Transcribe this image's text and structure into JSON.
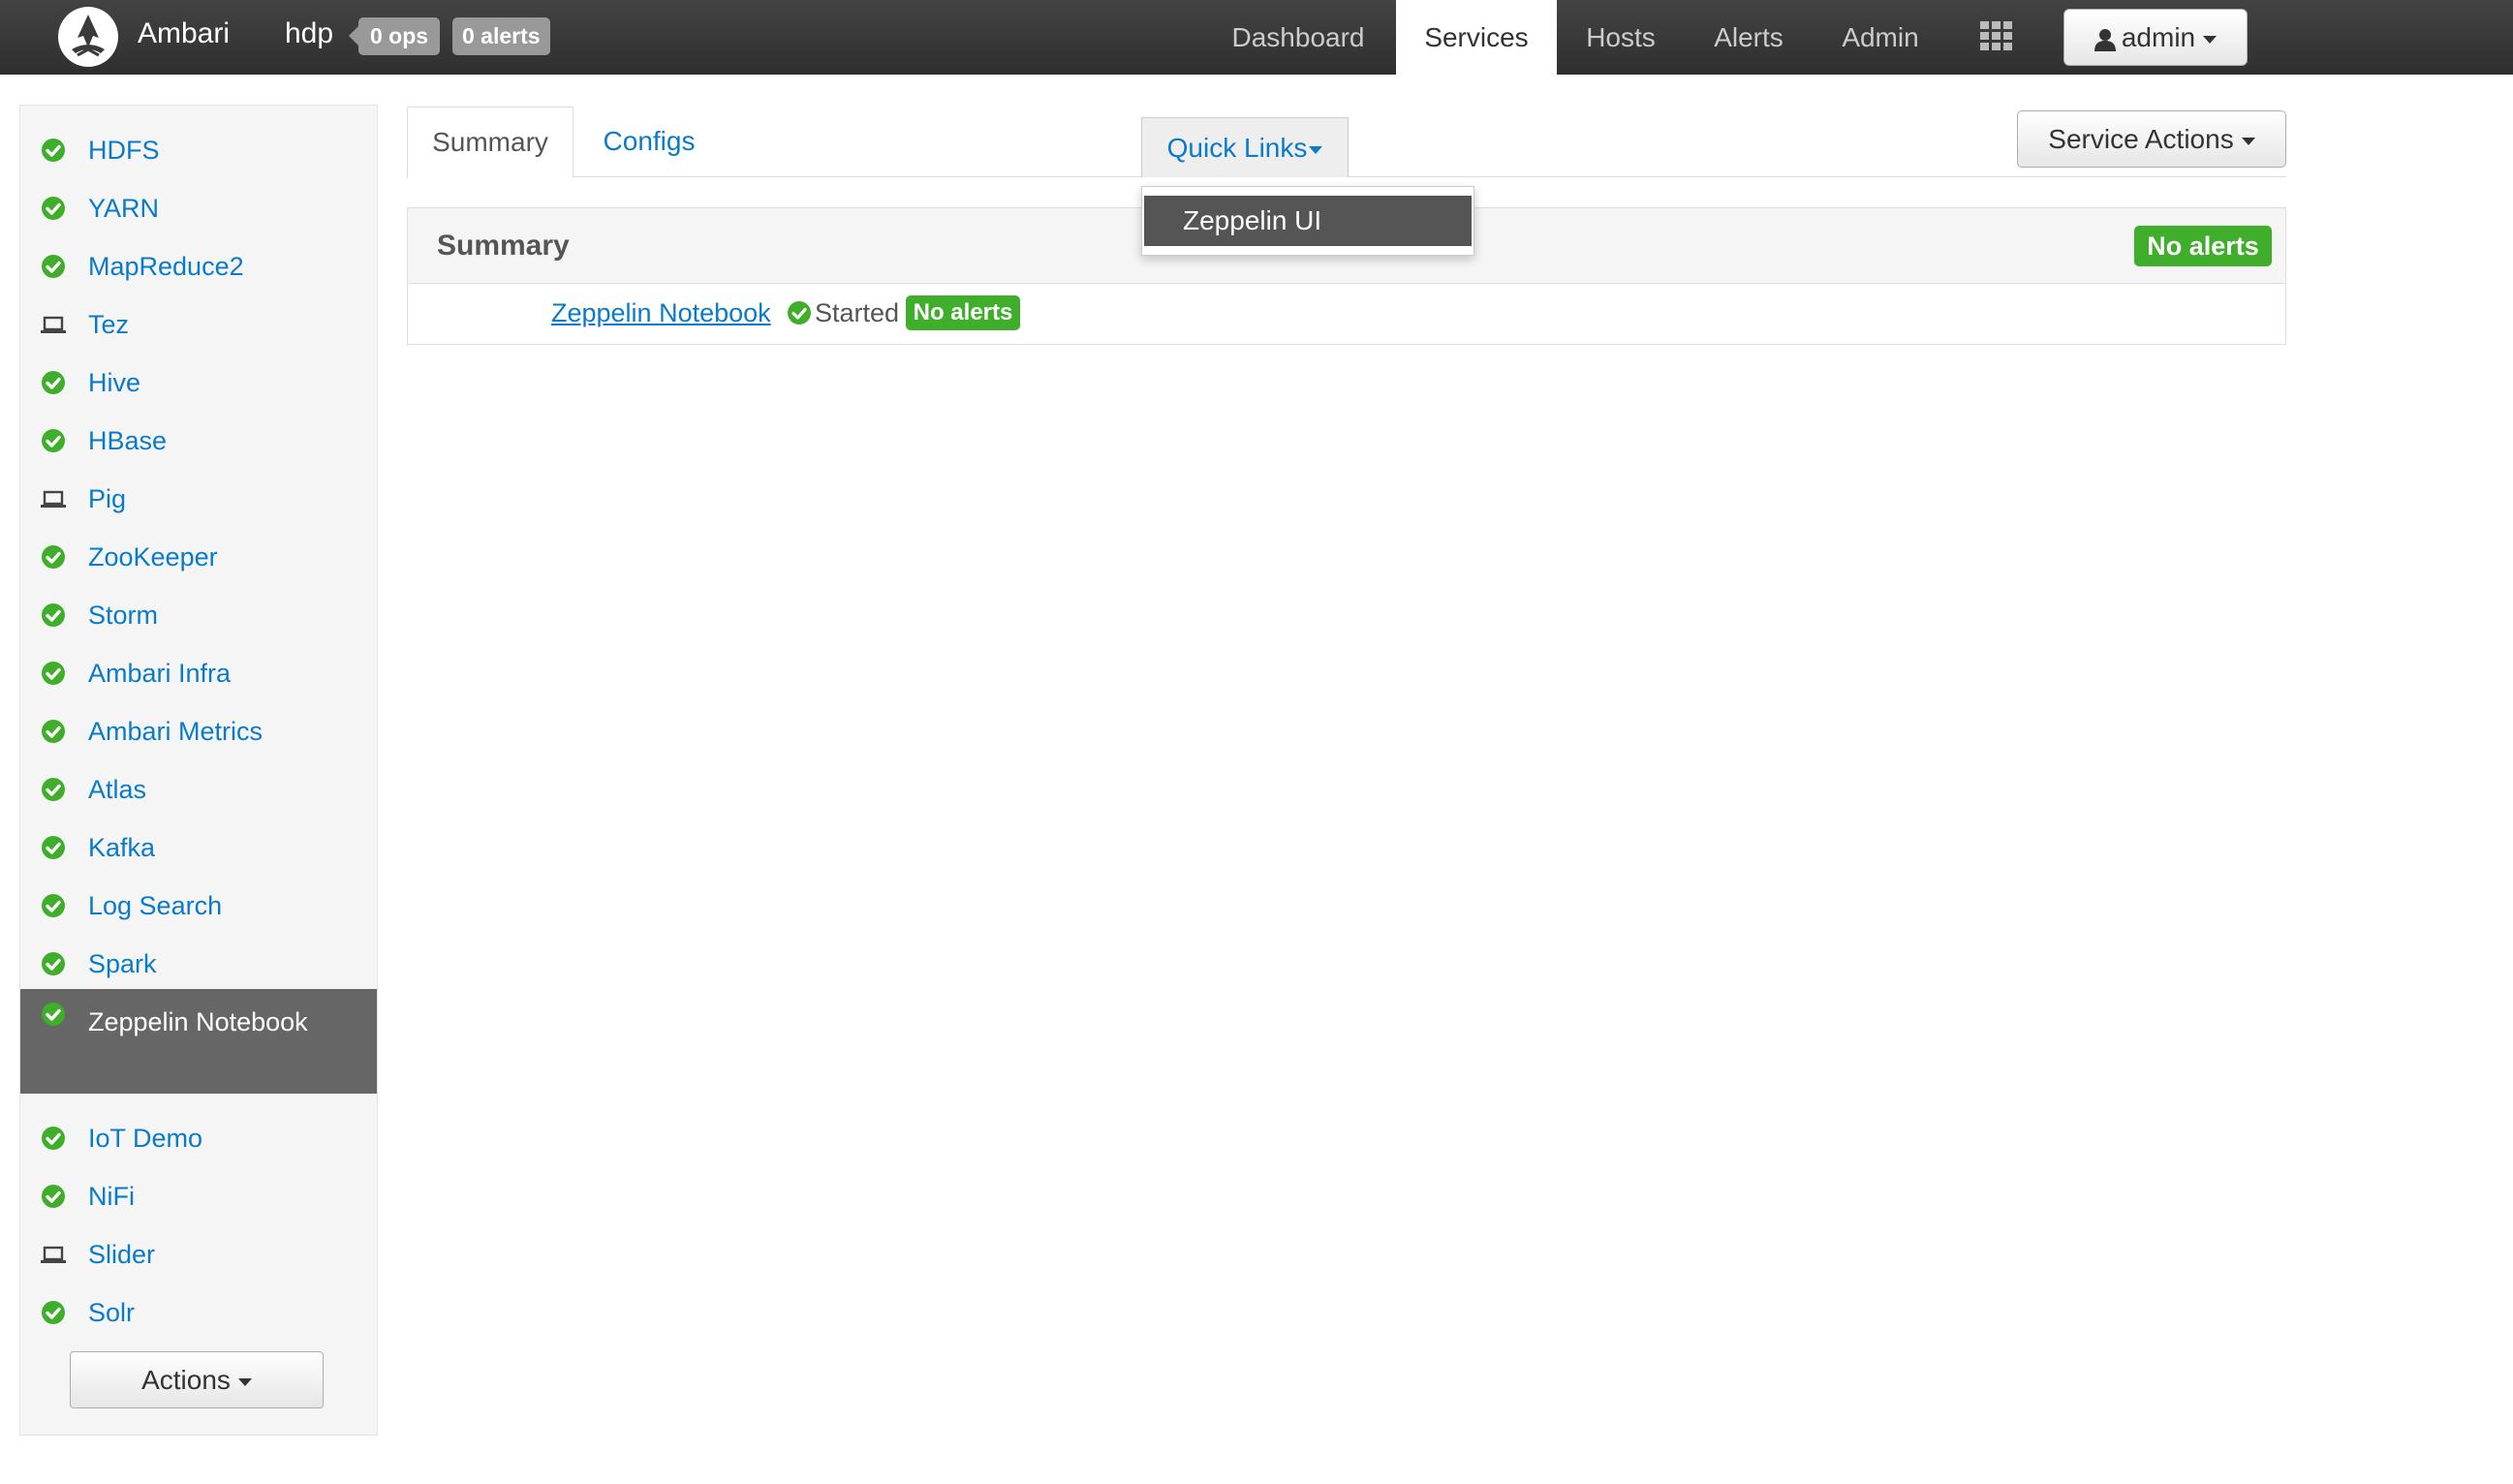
{
  "app": {
    "brand": "Ambari",
    "cluster": "hdp",
    "ops_badge": "0 ops",
    "alerts_badge": "0 alerts"
  },
  "nav": {
    "items": [
      {
        "label": "Dashboard",
        "active": false
      },
      {
        "label": "Services",
        "active": true
      },
      {
        "label": "Hosts",
        "active": false
      },
      {
        "label": "Alerts",
        "active": false
      },
      {
        "label": "Admin",
        "active": false
      }
    ],
    "apps_icon": "grid-icon",
    "user": "admin"
  },
  "sidebar": {
    "services": [
      {
        "label": "HDFS",
        "icon": "check-circle-icon"
      },
      {
        "label": "YARN",
        "icon": "check-circle-icon"
      },
      {
        "label": "MapReduce2",
        "icon": "check-circle-icon"
      },
      {
        "label": "Tez",
        "icon": "laptop-icon"
      },
      {
        "label": "Hive",
        "icon": "check-circle-icon"
      },
      {
        "label": "HBase",
        "icon": "check-circle-icon"
      },
      {
        "label": "Pig",
        "icon": "laptop-icon"
      },
      {
        "label": "ZooKeeper",
        "icon": "check-circle-icon"
      },
      {
        "label": "Storm",
        "icon": "check-circle-icon"
      },
      {
        "label": "Ambari Infra",
        "icon": "check-circle-icon"
      },
      {
        "label": "Ambari Metrics",
        "icon": "check-circle-icon"
      },
      {
        "label": "Atlas",
        "icon": "check-circle-icon"
      },
      {
        "label": "Kafka",
        "icon": "check-circle-icon"
      },
      {
        "label": "Log Search",
        "icon": "check-circle-icon"
      },
      {
        "label": "Spark",
        "icon": "check-circle-icon"
      },
      {
        "label": "Zeppelin Notebook",
        "icon": "check-circle-icon",
        "active": true
      },
      {
        "label": "IoT Demo",
        "icon": "check-circle-icon"
      },
      {
        "label": "NiFi",
        "icon": "check-circle-icon"
      },
      {
        "label": "Slider",
        "icon": "laptop-icon"
      },
      {
        "label": "Solr",
        "icon": "check-circle-icon"
      }
    ],
    "actions_label": "Actions"
  },
  "main": {
    "tabs": [
      {
        "label": "Summary",
        "active": true
      },
      {
        "label": "Configs",
        "active": false
      }
    ],
    "quick_links_label": "Quick Links",
    "quick_links_items": [
      "Zeppelin UI"
    ],
    "service_actions_label": "Service Actions",
    "summary": {
      "title": "Summary",
      "alerts_badge": "No alerts",
      "component": {
        "name": "Zeppelin Notebook",
        "status": "Started",
        "alerts": "No alerts"
      }
    }
  },
  "colors": {
    "link": "#0a7aca",
    "ok_green": "#3fae2a",
    "nav_bg": "#3a3a3a",
    "active_sidebar": "#666666"
  }
}
